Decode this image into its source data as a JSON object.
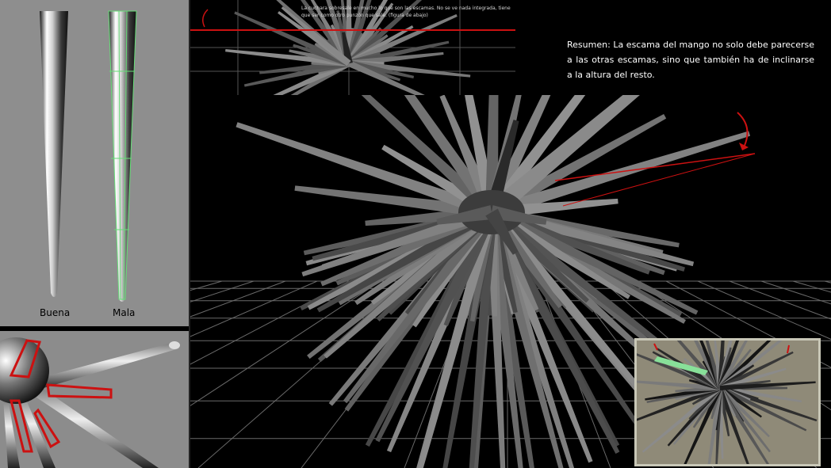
{
  "left_panel": {
    "good_label": "Buena",
    "bad_label": "Mala"
  },
  "top_note": {
    "text": "La cuchara sobresale en mucho lo que son las escamas. No se ve nada integrada, tiene que ser como otro punzón que sale. (figura de abajo)"
  },
  "summary": {
    "text": "Resumen: La escama del mango no solo debe parecerse a las otras escamas, sino que también ha de inclinarse a la altura del resto."
  },
  "colors": {
    "viewport_gray": "#8e8e8e",
    "background": "#000000",
    "annotation_red": "#cc1111",
    "wireframe_green": "#66dd77",
    "thumb_bg": "#8f8a78"
  },
  "icons": [
    "curved-arrow-icon",
    "red-marker-icon"
  ]
}
